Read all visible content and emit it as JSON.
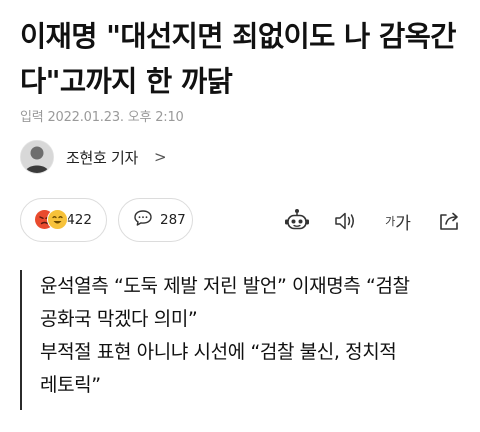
{
  "article": {
    "headline": "이재명 \"대선지면 죄없이도 나 감옥간다\"고까지 한 까닭",
    "meta": "입력 2022.01.23. 오후 2:10",
    "author": {
      "name": "조현호 기자",
      "chevron": ">"
    }
  },
  "toolbar": {
    "reaction_count": "422",
    "comment_count": "287",
    "font_size_label_small": "가",
    "font_size_label_big": "가"
  },
  "summary": {
    "lines": [
      "윤석열측 “도둑 제발 저린 발언” 이재명측 “검찰",
      "공화국 막겠다 의미”",
      "부적절 표현 아니냐 시선에 “검찰 불신, 정치적",
      "레토릭”"
    ]
  },
  "icons": {
    "reaction_emojis": [
      "angry-emoji-icon",
      "laughing-emoji-icon"
    ],
    "comment": "speech-bubble-icon",
    "bot": "robot-icon",
    "tts": "speaker-icon",
    "font_size": "font-size-icon",
    "share": "share-icon"
  },
  "colors": {
    "angry": "#e94b2e",
    "laugh": "#f7c23a",
    "border": "#dcdcdc",
    "meta_text": "#9a9a9a"
  }
}
